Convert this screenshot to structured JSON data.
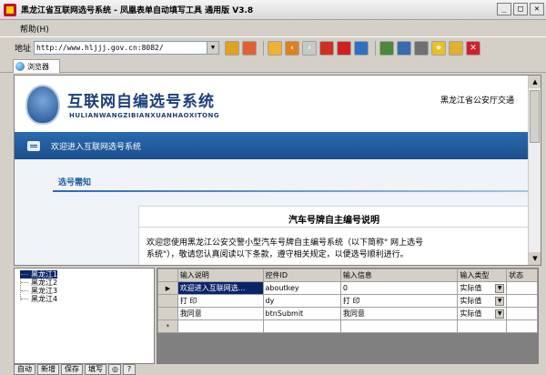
{
  "window": {
    "title": "黑龙江省互联网选号系统 - 凤凰表单自动填写工具 通用版 V3.8",
    "controls": [
      "_",
      "□",
      "✕"
    ]
  },
  "menu": {
    "help": "帮助(H)"
  },
  "toolbar": {
    "address_label": "地址",
    "address_value": "http://www.hljjj.gov.cn:8082/",
    "dropdown_arrow": "▼"
  },
  "tabs": [
    {
      "label": "浏览器"
    }
  ],
  "page": {
    "site_name": "互联网自编选号系统",
    "site_pinyin": "HULIANWANGZIBIANXUANHAOXITONG",
    "department": "黑龙江省公安厅交通",
    "welcome": "欢迎进入互联网选号系统",
    "notice_title": "选号需知",
    "doc_title": "汽车号牌自主编号说明",
    "doc_body_1": "欢迎您使用黑龙江公安交警小型汽车号牌自主编号系统（以下简称\" 网上选号",
    "doc_body_2": "系统\"），敬请您认真阅读以下条款，遵守相关规定，以便选号顺利进行。"
  },
  "tree": {
    "items": [
      "黑龙江1",
      "黑龙江2",
      "黑龙江3",
      "黑龙江4"
    ],
    "selected_index": 0
  },
  "grid": {
    "headers": [
      "输入说明",
      "控件ID",
      "输入信息",
      "输入类型",
      "状态"
    ],
    "rows": [
      {
        "marker": "▶",
        "cells": [
          "欢迎进入互联网选...",
          "aboutkey",
          "0",
          "实际值"
        ]
      },
      {
        "marker": "",
        "cells": [
          "打 印",
          "dy",
          "打 印",
          "实际值"
        ]
      },
      {
        "marker": "",
        "cells": [
          "我同意",
          "btnSubmit",
          "我同意",
          "实际值"
        ]
      },
      {
        "marker": "*",
        "cells": [
          "",
          "",
          "",
          ""
        ]
      }
    ]
  },
  "bottom_buttons": {
    "auto": "自动",
    "add": "新增",
    "save": "保存",
    "fill": "填写",
    "help": "?"
  },
  "colors": {
    "accent_blue": "#1b4f8c",
    "selection": "#0a246a",
    "title_red": "#c8102e"
  }
}
